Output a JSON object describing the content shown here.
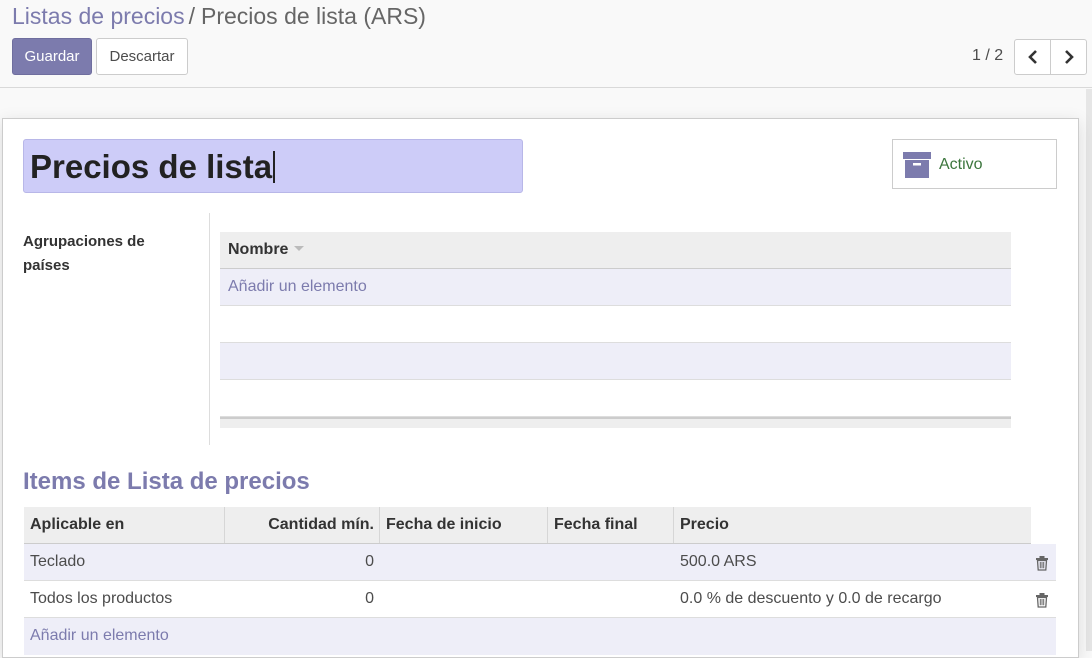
{
  "breadcrumb": {
    "parent": "Listas de precios",
    "separator": "/",
    "current": "Precios de lista (ARS)"
  },
  "buttons": {
    "save": "Guardar",
    "discard": "Descartar"
  },
  "pager": {
    "value": "1 / 2"
  },
  "form": {
    "name": "Precios de lista",
    "stat_button": "Activo",
    "country_groups_label": "Agrupaciones de países",
    "country_groups": {
      "column": "Nombre",
      "add": "Añadir un elemento"
    },
    "items_title": "Items de Lista de precios",
    "items": {
      "columns": [
        "Aplicable en",
        "Cantidad mín.",
        "Fecha de inicio",
        "Fecha final",
        "Precio"
      ],
      "rows": [
        {
          "applied_on": "Teclado",
          "min_qty": "0",
          "date_start": "",
          "date_end": "",
          "price": "500.0 ARS"
        },
        {
          "applied_on": "Todos los productos",
          "min_qty": "0",
          "date_start": "",
          "date_end": "",
          "price": "0.0 % de descuento y 0.0 de recargo"
        }
      ],
      "add": "Añadir un elemento"
    }
  },
  "colors": {
    "brand": "#7c7bad",
    "title_field_bg": "#cdccf8",
    "active_text": "#3c763d"
  },
  "icons": {
    "stat": "archive-icon",
    "row_delete": "trash-icon",
    "pager_prev": "chevron-left-icon",
    "pager_next": "chevron-right-icon",
    "sort": "caret-down-icon"
  }
}
